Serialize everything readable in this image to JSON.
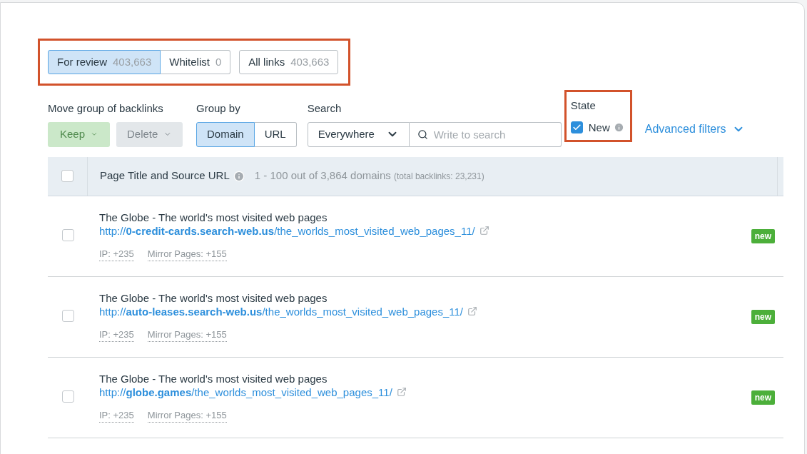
{
  "tabs": [
    {
      "label": "For review",
      "count": "403,663",
      "selected": true
    },
    {
      "label": "Whitelist",
      "count": "0",
      "selected": false
    }
  ],
  "all_links": {
    "label": "All links",
    "count": "403,663",
    "selected": false
  },
  "move_group": {
    "label": "Move group of backlinks",
    "buttons": [
      {
        "label": "Keep",
        "kind": "keep",
        "disabled": true
      },
      {
        "label": "Delete",
        "kind": "delete",
        "disabled": true
      }
    ]
  },
  "group_by": {
    "label": "Group by",
    "options": [
      {
        "label": "Domain",
        "selected": true
      },
      {
        "label": "URL",
        "selected": false
      }
    ]
  },
  "search": {
    "label": "Search",
    "scope": "Everywhere",
    "placeholder": "Write to search"
  },
  "state": {
    "label": "State",
    "option": "New",
    "checked": true
  },
  "advanced_filters": "Advanced filters",
  "table": {
    "header": {
      "checked": false,
      "column": "Page Title and Source URL",
      "summary": "1 - 100 out of 3,864 domains",
      "total": "(total backlinks: 23,231)"
    },
    "rows": [
      {
        "checked": false,
        "title": "The Globe - The world's most visited web pages",
        "url": "http://**0-credit-cards.search-web.us**/the_worlds_most_visited_web_pages_11/",
        "ip": "IP: +235",
        "mirror": "Mirror Pages: +155",
        "badge": "new"
      },
      {
        "checked": false,
        "title": "The Globe - The world's most visited web pages",
        "url": "http://**auto-leases.search-web.us**/the_worlds_most_visited_web_pages_11/",
        "ip": "IP: +235",
        "mirror": "Mirror Pages: +155",
        "badge": "new"
      },
      {
        "checked": false,
        "title": "The Globe - The world's most visited web pages",
        "url": "http://**globe.games**/the_worlds_most_visited_web_pages_11/",
        "ip": "IP: +235",
        "mirror": "Mirror Pages: +155",
        "badge": "new"
      }
    ]
  }
}
